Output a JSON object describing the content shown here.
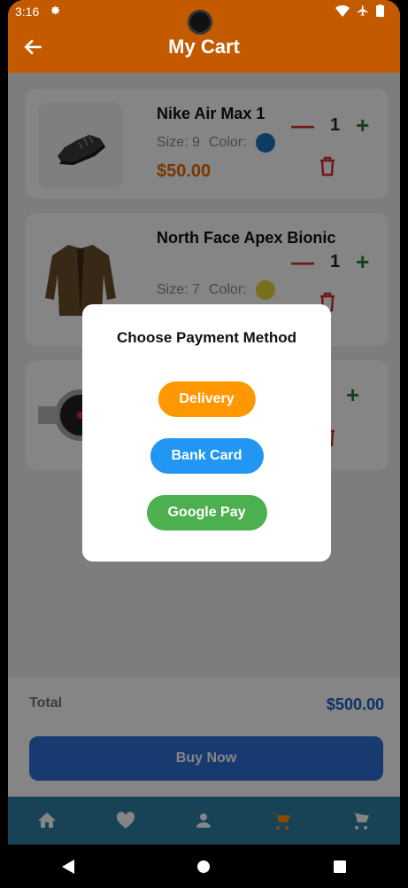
{
  "status_bar": {
    "time": "3:16"
  },
  "app_bar": {
    "title": "My Cart"
  },
  "cart": [
    {
      "name": "Nike Air Max 1",
      "size_label": "Size: 9",
      "color_label": "Color:",
      "color": "#1e73be",
      "price": "$50.00",
      "quantity": "1"
    },
    {
      "name": "North Face Apex Bionic",
      "size_label": "Size: 7",
      "color_label": "Color:",
      "color": "#e8d63a",
      "quantity": "1"
    },
    {
      "quantity": ""
    }
  ],
  "total": {
    "label": "Total",
    "value": "$500.00"
  },
  "buy_button": {
    "label": "Buy Now"
  },
  "dialog": {
    "title": "Choose Payment Method",
    "options": [
      {
        "label": "Delivery",
        "color": "#ff9800"
      },
      {
        "label": "Bank Card",
        "color": "#2196f3"
      },
      {
        "label": "Google Pay",
        "color": "#4caf50"
      }
    ]
  },
  "icons": [
    "home-icon",
    "heart-icon",
    "person-icon",
    "cart-icon",
    "add-cart-icon"
  ]
}
